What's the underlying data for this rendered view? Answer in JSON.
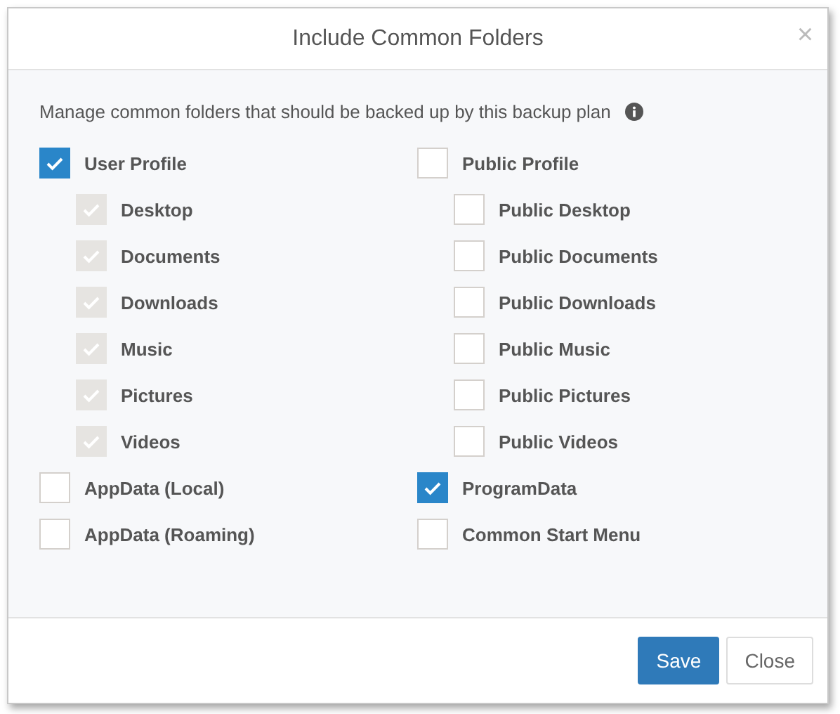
{
  "dialog": {
    "title": "Include Common Folders",
    "close_icon": "×"
  },
  "description": "Manage common folders that should be backed up by this backup plan",
  "columns": [
    {
      "items": [
        {
          "label": "User Profile",
          "checked": true,
          "disabled": false,
          "children": [
            {
              "label": "Desktop",
              "checked": true,
              "disabled": true
            },
            {
              "label": "Documents",
              "checked": true,
              "disabled": true
            },
            {
              "label": "Downloads",
              "checked": true,
              "disabled": true
            },
            {
              "label": "Music",
              "checked": true,
              "disabled": true
            },
            {
              "label": "Pictures",
              "checked": true,
              "disabled": true
            },
            {
              "label": "Videos",
              "checked": true,
              "disabled": true
            }
          ]
        },
        {
          "label": "AppData (Local)",
          "checked": false,
          "disabled": false
        },
        {
          "label": "AppData (Roaming)",
          "checked": false,
          "disabled": false
        }
      ]
    },
    {
      "items": [
        {
          "label": "Public Profile",
          "checked": false,
          "disabled": false,
          "children": [
            {
              "label": "Public Desktop",
              "checked": false,
              "disabled": false
            },
            {
              "label": "Public Documents",
              "checked": false,
              "disabled": false
            },
            {
              "label": "Public Downloads",
              "checked": false,
              "disabled": false
            },
            {
              "label": "Public Music",
              "checked": false,
              "disabled": false
            },
            {
              "label": "Public Pictures",
              "checked": false,
              "disabled": false
            },
            {
              "label": "Public Videos",
              "checked": false,
              "disabled": false
            }
          ]
        },
        {
          "label": "ProgramData",
          "checked": true,
          "disabled": false
        },
        {
          "label": "Common Start Menu",
          "checked": false,
          "disabled": false
        }
      ]
    }
  ],
  "buttons": [
    {
      "label": "Save",
      "kind": "primary"
    },
    {
      "label": "Close",
      "kind": "default"
    }
  ]
}
